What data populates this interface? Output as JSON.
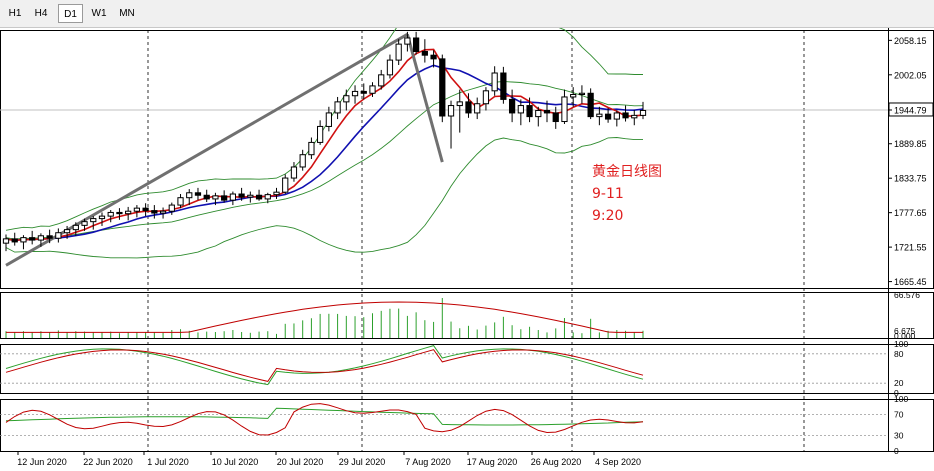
{
  "timeframes": [
    {
      "label": "H1",
      "active": false
    },
    {
      "label": "H4",
      "active": false
    },
    {
      "label": "D1",
      "active": true
    },
    {
      "label": "W1",
      "active": false
    },
    {
      "label": "MN",
      "active": false
    }
  ],
  "chart_data": {
    "type": "candlestick",
    "symbol_note": [
      "黄金日线图",
      "9-11",
      "9:20"
    ],
    "note_color": "#e02020",
    "last_price": "1944.79",
    "price_ticks": [
      "2058.15",
      "2002.05",
      "1944.79",
      "1889.85",
      "1833.75",
      "1777.65",
      "1721.55",
      "1665.45"
    ],
    "x_ticks": [
      "12 Jun 2020",
      "22 Jun 2020",
      "1 Jul 2020",
      "10 Jul 2020",
      "20 Jul 2020",
      "29 Jul 2020",
      "7 Aug 2020",
      "17 Aug 2020",
      "26 Aug 2020",
      "4 Sep 2020"
    ],
    "ylim": [
      1655,
      2075
    ],
    "candles": [
      [
        1728,
        1742,
        1715,
        1735
      ],
      [
        1735,
        1745,
        1724,
        1730
      ],
      [
        1730,
        1741,
        1718,
        1737
      ],
      [
        1737,
        1748,
        1726,
        1733
      ],
      [
        1733,
        1744,
        1722,
        1740
      ],
      [
        1740,
        1750,
        1728,
        1736
      ],
      [
        1736,
        1752,
        1729,
        1745
      ],
      [
        1745,
        1756,
        1735,
        1750
      ],
      [
        1750,
        1762,
        1740,
        1757
      ],
      [
        1757,
        1768,
        1748,
        1763
      ],
      [
        1763,
        1772,
        1750,
        1768
      ],
      [
        1768,
        1778,
        1756,
        1772
      ],
      [
        1772,
        1782,
        1762,
        1778
      ],
      [
        1778,
        1785,
        1766,
        1776
      ],
      [
        1776,
        1787,
        1765,
        1780
      ],
      [
        1780,
        1790,
        1770,
        1785
      ],
      [
        1785,
        1793,
        1772,
        1781
      ],
      [
        1781,
        1790,
        1768,
        1777
      ],
      [
        1777,
        1786,
        1768,
        1780
      ],
      [
        1780,
        1794,
        1774,
        1790
      ],
      [
        1790,
        1808,
        1785,
        1802
      ],
      [
        1802,
        1816,
        1790,
        1810
      ],
      [
        1810,
        1818,
        1798,
        1806
      ],
      [
        1806,
        1815,
        1795,
        1800
      ],
      [
        1800,
        1810,
        1790,
        1805
      ],
      [
        1805,
        1814,
        1794,
        1798
      ],
      [
        1798,
        1812,
        1790,
        1808
      ],
      [
        1808,
        1818,
        1797,
        1803
      ],
      [
        1803,
        1812,
        1794,
        1806
      ],
      [
        1806,
        1815,
        1797,
        1800
      ],
      [
        1800,
        1810,
        1793,
        1807
      ],
      [
        1807,
        1818,
        1800,
        1811
      ],
      [
        1811,
        1840,
        1808,
        1834
      ],
      [
        1834,
        1860,
        1828,
        1852
      ],
      [
        1852,
        1880,
        1846,
        1872
      ],
      [
        1872,
        1900,
        1865,
        1892
      ],
      [
        1892,
        1928,
        1888,
        1918
      ],
      [
        1918,
        1950,
        1910,
        1940
      ],
      [
        1940,
        1966,
        1930,
        1958
      ],
      [
        1958,
        1978,
        1944,
        1968
      ],
      [
        1968,
        1985,
        1955,
        1975
      ],
      [
        1975,
        1988,
        1962,
        1972
      ],
      [
        1972,
        1990,
        1966,
        1984
      ],
      [
        1984,
        2010,
        1978,
        2002
      ],
      [
        2002,
        2035,
        1996,
        2026
      ],
      [
        2026,
        2060,
        2018,
        2052
      ],
      [
        2052,
        2072,
        2040,
        2062
      ],
      [
        2062,
        2072,
        2035,
        2040
      ],
      [
        2040,
        2060,
        2022,
        2034
      ],
      [
        2034,
        2042,
        2014,
        2028
      ],
      [
        2028,
        2035,
        1925,
        1935
      ],
      [
        1935,
        1960,
        1882,
        1952
      ],
      [
        1952,
        1978,
        1908,
        1958
      ],
      [
        1958,
        1972,
        1932,
        1940
      ],
      [
        1940,
        1965,
        1930,
        1955
      ],
      [
        1955,
        1982,
        1944,
        1976
      ],
      [
        1976,
        2016,
        1968,
        2005
      ],
      [
        2005,
        2015,
        1955,
        1962
      ],
      [
        1962,
        1978,
        1925,
        1940
      ],
      [
        1940,
        1962,
        1920,
        1952
      ],
      [
        1952,
        1965,
        1925,
        1934
      ],
      [
        1934,
        1950,
        1918,
        1944
      ],
      [
        1944,
        1960,
        1925,
        1940
      ],
      [
        1940,
        1950,
        1914,
        1926
      ],
      [
        1926,
        1978,
        1922,
        1966
      ],
      [
        1966,
        1982,
        1950,
        1970
      ],
      [
        1970,
        1985,
        1955,
        1972
      ],
      [
        1972,
        1980,
        1930,
        1934
      ],
      [
        1934,
        1950,
        1920,
        1938
      ],
      [
        1938,
        1948,
        1924,
        1930
      ],
      [
        1930,
        1944,
        1918,
        1940
      ],
      [
        1940,
        1952,
        1926,
        1932
      ],
      [
        1932,
        1945,
        1920,
        1936
      ],
      [
        1936,
        1958,
        1930,
        1944
      ]
    ],
    "indicator_ticks": {
      "volume": [
        "66.576",
        "6.675",
        "0.000"
      ],
      "stochastic": [
        "100",
        "80",
        "20",
        "0"
      ],
      "rsi": [
        "100",
        "70",
        "30",
        "0"
      ]
    }
  }
}
